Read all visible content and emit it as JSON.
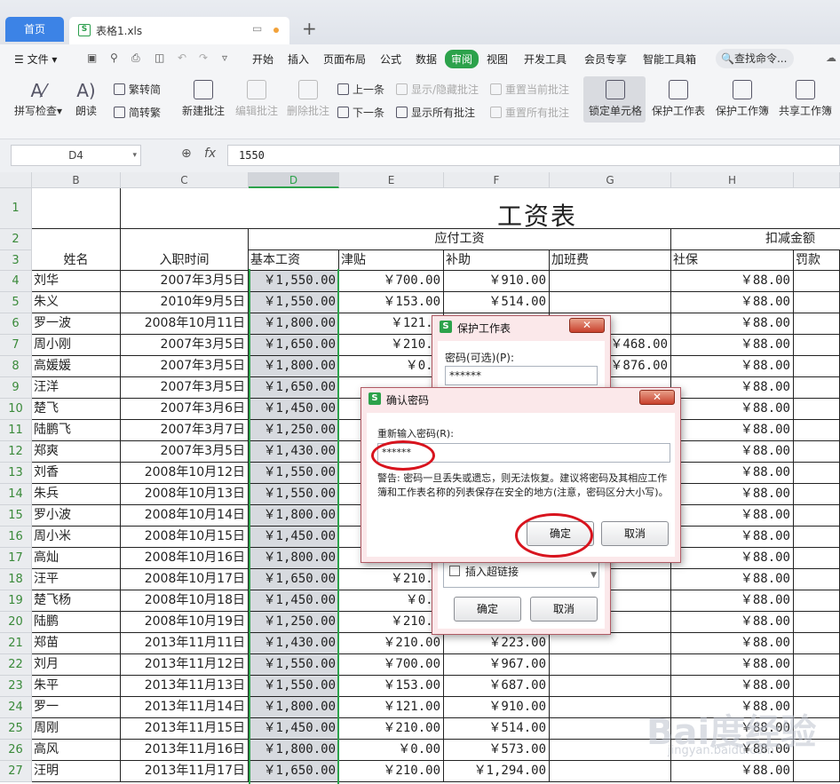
{
  "tabs": {
    "home": "首页",
    "file": "表格1.xls",
    "new_tab": "+"
  },
  "menu": {
    "file": "☰ 文件 ▾",
    "items": [
      "开始",
      "插入",
      "页面布局",
      "公式",
      "数据",
      "审阅",
      "视图",
      "开发工具",
      "会员专享",
      "智能工具箱"
    ],
    "active": "审阅",
    "search": "🔍查找命令..."
  },
  "ribbon": {
    "spell": "拼写检查▾",
    "read": "朗读",
    "trad": "繁转简",
    "simp": "简转繁",
    "new_comment": "新建批注",
    "edit_comment": "编辑批注",
    "delete_comment": "删除批注",
    "prev": "上一条",
    "next": "下一条",
    "show_hide": "显示/隐藏批注",
    "show_all": "显示所有批注",
    "reset_current": "重置当前批注",
    "reset_all": "重置所有批注",
    "lock_cell": "锁定单元格",
    "protect_sheet": "保护工作表",
    "protect_book": "保护工作簿",
    "share_book": "共享工作簿"
  },
  "formula": {
    "cell_ref": "D4",
    "value": "1550",
    "fx": "fx",
    "zoom": "⊕"
  },
  "columns": [
    "B",
    "C",
    "D",
    "E",
    "F",
    "G",
    "H"
  ],
  "sheet": {
    "title": "工资表",
    "payable": "应付工资",
    "deduct": "扣减金额",
    "headers": [
      "姓名",
      "入职时间",
      "基本工资",
      "津贴",
      "补助",
      "加班费",
      "社保",
      "罚款"
    ],
    "rows": [
      [
        "刘华",
        "2007年3月5日",
        "￥1,550.00",
        "￥700.00",
        "￥910.00",
        "",
        "￥88.00"
      ],
      [
        "朱义",
        "2010年9月5日",
        "￥1,550.00",
        "￥153.00",
        "￥514.00",
        "",
        "￥88.00"
      ],
      [
        "罗一波",
        "2008年10月11日",
        "￥1,800.00",
        "￥121.0",
        "",
        "",
        "￥88.00"
      ],
      [
        "周小刚",
        "2007年3月5日",
        "￥1,650.00",
        "￥210.0",
        "",
        "￥468.00",
        "￥88.00"
      ],
      [
        "高媛媛",
        "2007年3月5日",
        "￥1,800.00",
        "￥0.0",
        "",
        "￥876.00",
        "￥88.00"
      ],
      [
        "汪洋",
        "2007年3月5日",
        "￥1,650.00",
        "",
        "",
        "",
        "￥88.00"
      ],
      [
        "楚飞",
        "2007年3月6日",
        "￥1,450.00",
        "",
        "",
        "",
        "￥88.00"
      ],
      [
        "陆鹏飞",
        "2007年3月7日",
        "￥1,250.00",
        "",
        "",
        "",
        "￥88.00"
      ],
      [
        "郑爽",
        "2007年3月5日",
        "￥1,430.00",
        "",
        "",
        "",
        "￥88.00"
      ],
      [
        "刘香",
        "2008年10月12日",
        "￥1,550.00",
        "",
        "",
        "",
        "￥88.00"
      ],
      [
        "朱兵",
        "2008年10月13日",
        "￥1,550.00",
        "",
        "",
        "",
        "￥88.00"
      ],
      [
        "罗小波",
        "2008年10月14日",
        "￥1,800.00",
        "",
        "",
        "",
        "￥88.00"
      ],
      [
        "周小米",
        "2008年10月15日",
        "￥1,450.00",
        "",
        "",
        "",
        "￥88.00"
      ],
      [
        "高灿",
        "2008年10月16日",
        "￥1,800.00",
        "",
        "",
        "",
        "￥88.00"
      ],
      [
        "汪平",
        "2008年10月17日",
        "￥1,650.00",
        "￥210.0",
        "",
        "",
        "￥88.00"
      ],
      [
        "楚飞杨",
        "2008年10月18日",
        "￥1,450.00",
        "￥0.0",
        "",
        "",
        "￥88.00"
      ],
      [
        "陆鹏",
        "2008年10月19日",
        "￥1,250.00",
        "￥210.0",
        "",
        "",
        "￥88.00"
      ],
      [
        "郑苗",
        "2013年11月11日",
        "￥1,430.00",
        "￥210.00",
        "￥223.00",
        "",
        "￥88.00"
      ],
      [
        "刘月",
        "2013年11月12日",
        "￥1,550.00",
        "￥700.00",
        "￥967.00",
        "",
        "￥88.00"
      ],
      [
        "朱平",
        "2013年11月13日",
        "￥1,550.00",
        "￥153.00",
        "￥687.00",
        "",
        "￥88.00"
      ],
      [
        "罗一",
        "2013年11月14日",
        "￥1,800.00",
        "￥121.00",
        "￥910.00",
        "",
        "￥88.00"
      ],
      [
        "周刚",
        "2013年11月15日",
        "￥1,450.00",
        "￥210.00",
        "￥514.00",
        "",
        "￥88.00"
      ],
      [
        "高风",
        "2013年11月16日",
        "￥1,800.00",
        "￥0.00",
        "￥573.00",
        "",
        "￥88.00"
      ],
      [
        "汪明",
        "2013年11月17日",
        "￥1,650.00",
        "￥210.00",
        "￥1,294.00",
        "",
        "￥88.00"
      ]
    ]
  },
  "protect_dialog": {
    "title": "保护工作表",
    "password_label": "密码(可选)(P):",
    "password_value": "******",
    "option_hyperlink": "插入超链接",
    "ok": "确定",
    "cancel": "取消"
  },
  "confirm_dialog": {
    "title": "确认密码",
    "reenter_label": "重新输入密码(R):",
    "password_value": "******",
    "warning": "警告: 密码一旦丢失或遗忘，则无法恢复。建议将密码及其相应工作簿和工作表名称的列表保存在安全的地方(注意，密码区分大小写)。",
    "ok": "确定",
    "cancel": "取消"
  },
  "watermark": {
    "main": "Bai度经验",
    "sub": "jingyan.baidu.com"
  },
  "colors": {
    "accent": "#2ca24b",
    "home_tab": "#3c83e6",
    "annotation": "#d8141e"
  }
}
